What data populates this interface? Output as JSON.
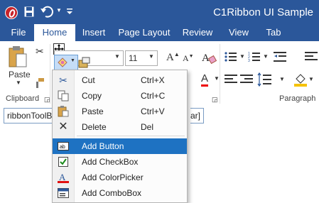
{
  "window": {
    "title": "C1Ribbon UI Sample"
  },
  "tabs": [
    {
      "label": "File"
    },
    {
      "label": "Home"
    },
    {
      "label": "Insert"
    },
    {
      "label": "Page Layout"
    },
    {
      "label": "Review"
    },
    {
      "label": "View"
    },
    {
      "label": "Tab"
    }
  ],
  "ribbon": {
    "paste_label": "Paste",
    "font_size": "11",
    "groups": {
      "clipboard": "Clipboard",
      "paragraph": "Paragraph"
    }
  },
  "context_menu": {
    "items": [
      {
        "label": "Cut",
        "shortcut": "Ctrl+X",
        "icon": "scissors-icon"
      },
      {
        "label": "Copy",
        "shortcut": "Ctrl+C",
        "icon": "copy-icon"
      },
      {
        "label": "Paste",
        "shortcut": "Ctrl+V",
        "icon": "paste-icon"
      },
      {
        "label": "Delete",
        "shortcut": "Del",
        "icon": "delete-icon"
      }
    ],
    "add_items": [
      {
        "label": "Add Button",
        "icon": "button-icon",
        "highlighted": true
      },
      {
        "label": "Add CheckBox",
        "icon": "checkbox-icon"
      },
      {
        "label": "Add ColorPicker",
        "icon": "colorpicker-icon"
      },
      {
        "label": "Add ComboBox",
        "icon": "combobox-icon"
      }
    ]
  },
  "editor": {
    "text_start": "ribbonToolB",
    "text_end": "ar]"
  },
  "colors": {
    "accent": "#2b579a",
    "highlight": "#1e72c2"
  }
}
